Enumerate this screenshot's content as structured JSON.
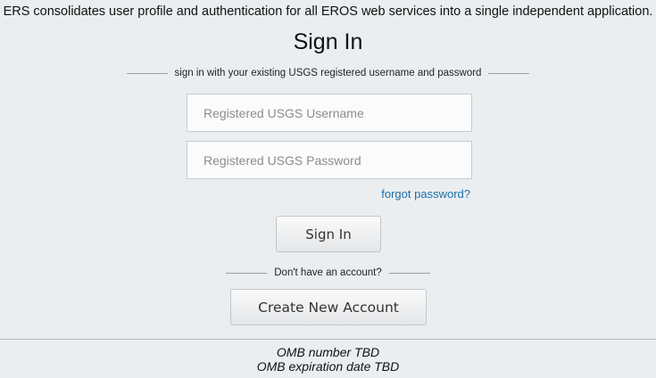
{
  "intro_text": "ERS consolidates user profile and authentication for all EROS web services into a single independent application.",
  "title": "Sign In",
  "signin_divider": "sign in with your existing USGS registered username and password",
  "username": {
    "placeholder": "Registered USGS Username",
    "value": ""
  },
  "password": {
    "placeholder": "Registered USGS Password",
    "value": ""
  },
  "forgot_password": "forgot password?",
  "signin_button": "Sign In",
  "account_divider": "Don't have an account?",
  "create_account_button": "Create New Account",
  "footer": {
    "omb_number": "OMB number TBD",
    "omb_expiration": "OMB expiration date TBD"
  },
  "colors": {
    "background": "#ebeef0",
    "link": "#1e6fa8"
  }
}
